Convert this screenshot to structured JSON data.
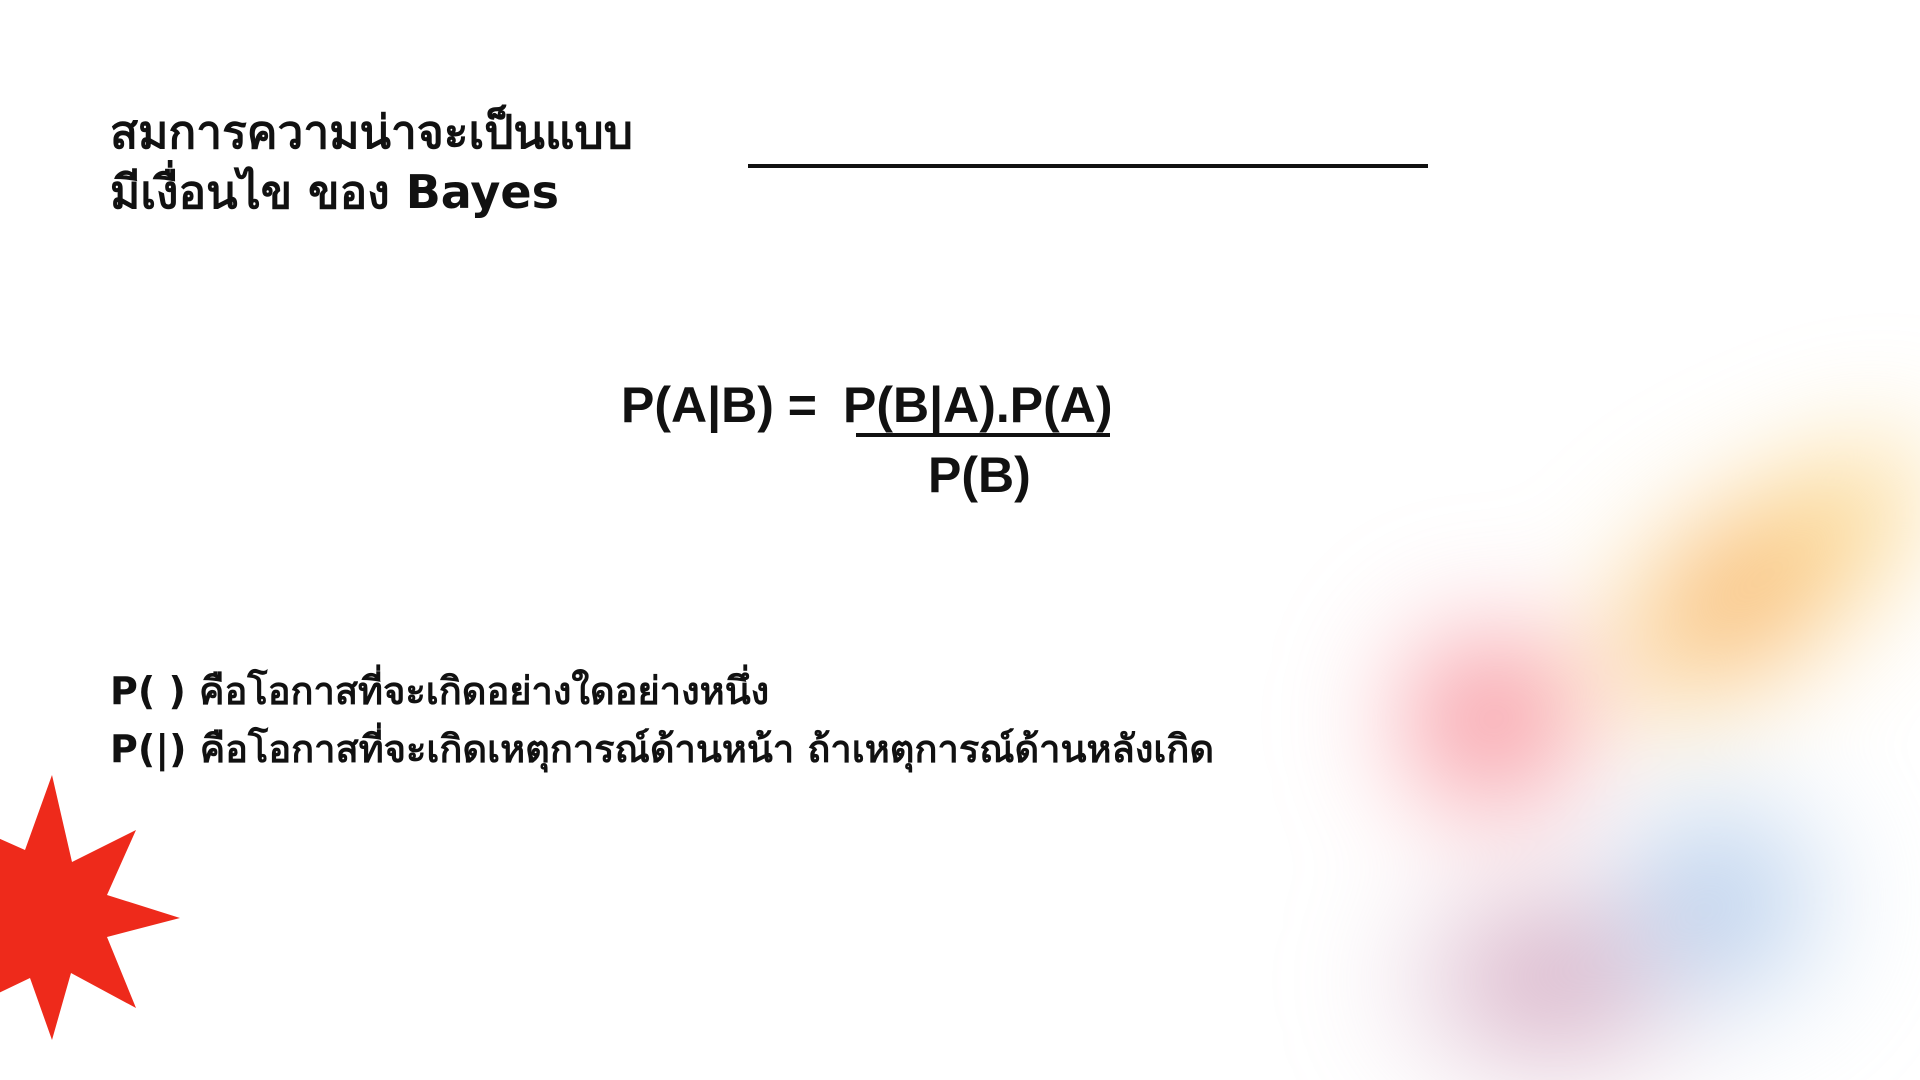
{
  "title": {
    "line1": "สมการความน่าจะเป็นแบบ",
    "line2": "มีเงื่อนไข ของ Bayes"
  },
  "formula": {
    "lhs": "P(A|B) =",
    "numerator": "P(B|A).P(A)",
    "denominator": "P(B)"
  },
  "definitions": [
    "P( ) คือโอกาสที่จะเกิดอย่างใดอย่างหนึ่ง",
    "P(|) คือโอกาสที่จะเกิดเหตุการณ์ด้านหน้า ถ้าเหตุการณ์ด้านหลังเกิด"
  ],
  "colors": {
    "text": "#111111",
    "starburst": "#ee2a1b",
    "background": "#ffffff"
  },
  "decorations": {
    "starburst_icon": "red-starburst",
    "gradient_blob": "blurred-gradient-blob"
  }
}
